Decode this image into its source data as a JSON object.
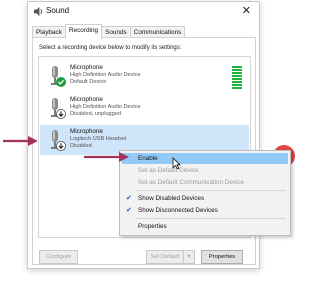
{
  "window": {
    "title": "Sound",
    "close_glyph": "✕"
  },
  "tabs": [
    {
      "label": "Playback"
    },
    {
      "label": "Recording"
    },
    {
      "label": "Sounds"
    },
    {
      "label": "Communications"
    }
  ],
  "instruction": "Select a recording device below to modify its settings:",
  "devices": [
    {
      "name": "Microphone",
      "line1": "High Definition Audio Device",
      "line2": "Default Device",
      "status_icon": "check-badge-icon"
    },
    {
      "name": "Microphone",
      "line1": "High Definition Audio Device",
      "line2": "Disabled, unplugged",
      "status_icon": "down-arrow-badge-icon"
    },
    {
      "name": "Microphone",
      "line1": "Logitech USB Headset",
      "line2": "Disabled",
      "status_icon": "down-arrow-badge-icon"
    }
  ],
  "buttons": {
    "configure": "Configure",
    "set_default": "Set Default",
    "set_default_arrow": "▾",
    "properties": "Properties"
  },
  "context_menu": [
    {
      "label": "Enable"
    },
    {
      "label": "Set as Default Device"
    },
    {
      "label": "Set as Default Communication Device"
    },
    {
      "label": "Show Disabled Devices",
      "checked": true
    },
    {
      "label": "Show Disconnected Devices",
      "checked": true
    },
    {
      "label": "Properties"
    }
  ],
  "colors": {
    "arrow": "#a3325c",
    "selection": "#cfe5fa",
    "menu_highlight": "#91c9f7",
    "level_meter": "#1fb33a"
  }
}
